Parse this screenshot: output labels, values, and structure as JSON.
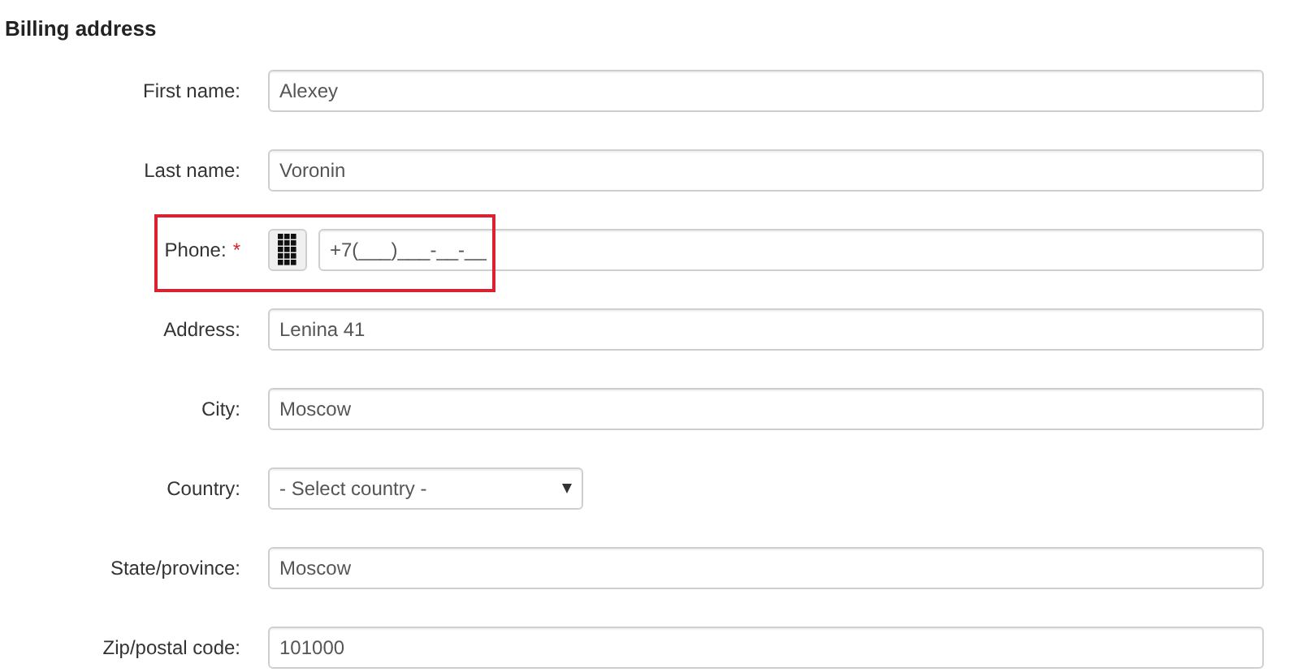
{
  "title": "Billing address",
  "fields": [
    {
      "kind": "text",
      "label": "First name:",
      "value": "Alexey"
    },
    {
      "kind": "text",
      "label": "Last name:",
      "value": "Voronin"
    },
    {
      "kind": "phone",
      "label": "Phone:",
      "required_mark": "*",
      "value": "+7(___)___-__-__",
      "highlighted": true
    },
    {
      "kind": "text",
      "label": "Address:",
      "value": "Lenina 41"
    },
    {
      "kind": "text",
      "label": "City:",
      "value": "Moscow"
    },
    {
      "kind": "select",
      "label": "Country:",
      "value": "- Select country -"
    },
    {
      "kind": "text",
      "label": "State/province:",
      "value": "Moscow"
    },
    {
      "kind": "text",
      "label": "Zip/postal code:",
      "value": "101000"
    }
  ]
}
